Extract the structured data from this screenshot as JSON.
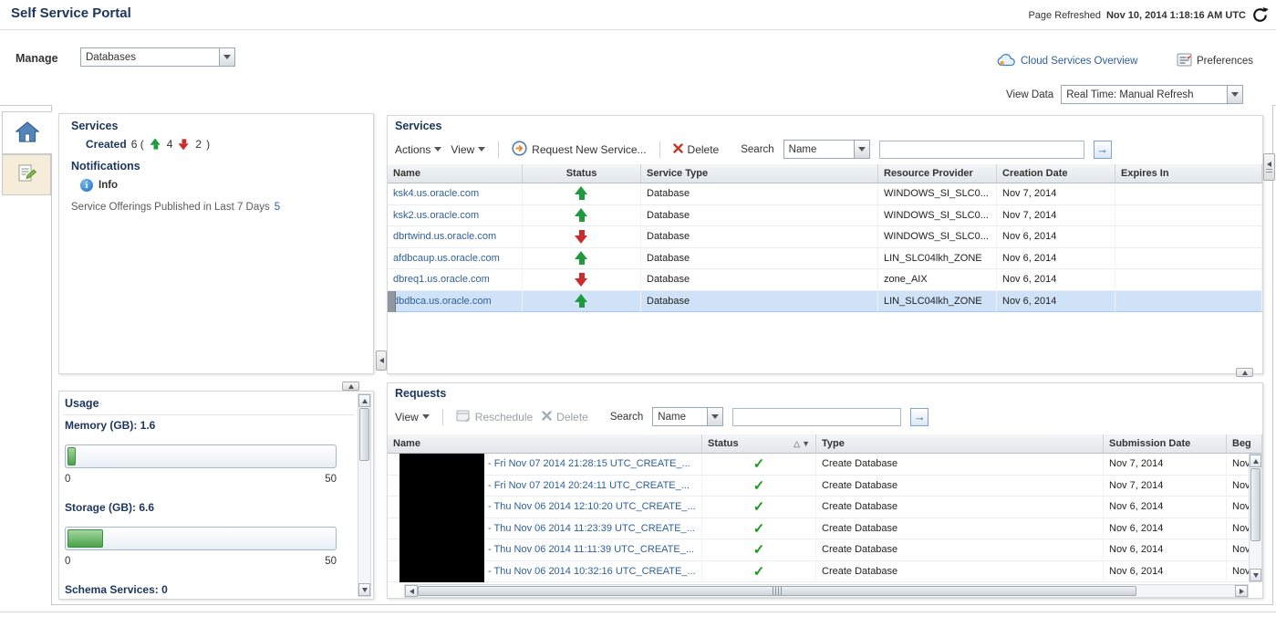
{
  "colors": {
    "accent_navy": "#1c355e",
    "link_blue": "#2d5f9a",
    "status_up_green": "#1e9a3c",
    "status_down_red": "#cc2b2b",
    "selected_row_blue": "#cfe2f7",
    "check_green": "#1a9a1a"
  },
  "icons": {
    "info_glyph": "i",
    "go_arrow": "→"
  },
  "header": {
    "title": "Self Service Portal",
    "refreshed_label": "Page Refreshed",
    "refreshed_value": "Nov 10, 2014 1:18:16 AM UTC"
  },
  "manage_bar": {
    "label": "Manage",
    "selected": "Databases",
    "cloud_overview_label": "Cloud Services Overview",
    "preferences_label": "Preferences"
  },
  "view_data": {
    "label": "View Data",
    "selected": "Real Time: Manual Refresh"
  },
  "summary": {
    "services_title": "Services",
    "created_label": "Created",
    "created_open": "6 (",
    "up_count": "4",
    "down_count": "2",
    "created_close": ")",
    "notifications_title": "Notifications",
    "info_label": "Info",
    "offerings_text": "Service Offerings Published in Last 7 Days",
    "offerings_count": "5"
  },
  "usage": {
    "title": "Usage",
    "memory_label": "Memory (GB): 1.6",
    "memory_min": "0",
    "memory_max": "50",
    "memory_pct": 3.2,
    "storage_label": "Storage (GB): 6.6",
    "storage_min": "0",
    "storage_max": "50",
    "storage_pct": 13.2,
    "schema_label": "Schema Services: 0"
  },
  "services_panel": {
    "title": "Services",
    "toolbar": {
      "actions": "Actions",
      "view": "View",
      "request_new": "Request New Service...",
      "delete": "Delete",
      "search_label": "Search",
      "search_by": "Name",
      "search_value": ""
    },
    "columns": [
      "Name",
      "Status",
      "Service Type",
      "Resource Provider",
      "Creation Date",
      "Expires In"
    ],
    "rows": [
      {
        "name": "ksk4.us.oracle.com",
        "status": "up",
        "type": "Database",
        "provider": "WINDOWS_SI_SLC0...",
        "created": "Nov 7, 2014",
        "expires": ""
      },
      {
        "name": "ksk2.us.oracle.com",
        "status": "up",
        "type": "Database",
        "provider": "WINDOWS_SI_SLC0...",
        "created": "Nov 7, 2014",
        "expires": ""
      },
      {
        "name": "dbrtwind.us.oracle.com",
        "status": "down",
        "type": "Database",
        "provider": "WINDOWS_SI_SLC0...",
        "created": "Nov 6, 2014",
        "expires": ""
      },
      {
        "name": "afdbcaup.us.oracle.com",
        "status": "up",
        "type": "Database",
        "provider": "LIN_SLC04lkh_ZONE",
        "created": "Nov 6, 2014",
        "expires": ""
      },
      {
        "name": "dbreq1.us.oracle.com",
        "status": "down",
        "type": "Database",
        "provider": "zone_AIX",
        "created": "Nov 6, 2014",
        "expires": ""
      },
      {
        "name": "dbdbca.us.oracle.com",
        "status": "up",
        "type": "Database",
        "provider": "LIN_SLC04lkh_ZONE",
        "created": "Nov 6, 2014",
        "expires": "",
        "selected": true
      }
    ]
  },
  "requests_panel": {
    "title": "Requests",
    "toolbar": {
      "view": "View",
      "reschedule": "Reschedule",
      "delete": "Delete",
      "search_label": "Search",
      "search_by": "Name",
      "search_value": ""
    },
    "columns": [
      "Name",
      "Status",
      "Type",
      "Submission Date",
      "Beg"
    ],
    "rows": [
      {
        "name": "- Fri Nov 07 2014 21:28:15 UTC_CREATE_...",
        "status": "success",
        "type": "Create Database",
        "submitted": "Nov 7, 2014",
        "begin": "Nov"
      },
      {
        "name": "- Fri Nov 07 2014 20:24:11 UTC_CREATE_...",
        "status": "success",
        "type": "Create Database",
        "submitted": "Nov 7, 2014",
        "begin": "Nov"
      },
      {
        "name": "- Thu Nov 06 2014 12:10:20 UTC_CREATE_...",
        "status": "success",
        "type": "Create Database",
        "submitted": "Nov 6, 2014",
        "begin": "Nov"
      },
      {
        "name": "- Thu Nov 06 2014 11:23:39 UTC_CREATE_...",
        "status": "success",
        "type": "Create Database",
        "submitted": "Nov 6, 2014",
        "begin": "Nov"
      },
      {
        "name": "- Thu Nov 06 2014 11:11:39 UTC_CREATE_...",
        "status": "success",
        "type": "Create Database",
        "submitted": "Nov 6, 2014",
        "begin": "Nov"
      },
      {
        "name": "- Thu Nov 06 2014 10:32:16 UTC_CREATE_...",
        "status": "success",
        "type": "Create Database",
        "submitted": "Nov 6, 2014",
        "begin": "Nov"
      }
    ]
  }
}
